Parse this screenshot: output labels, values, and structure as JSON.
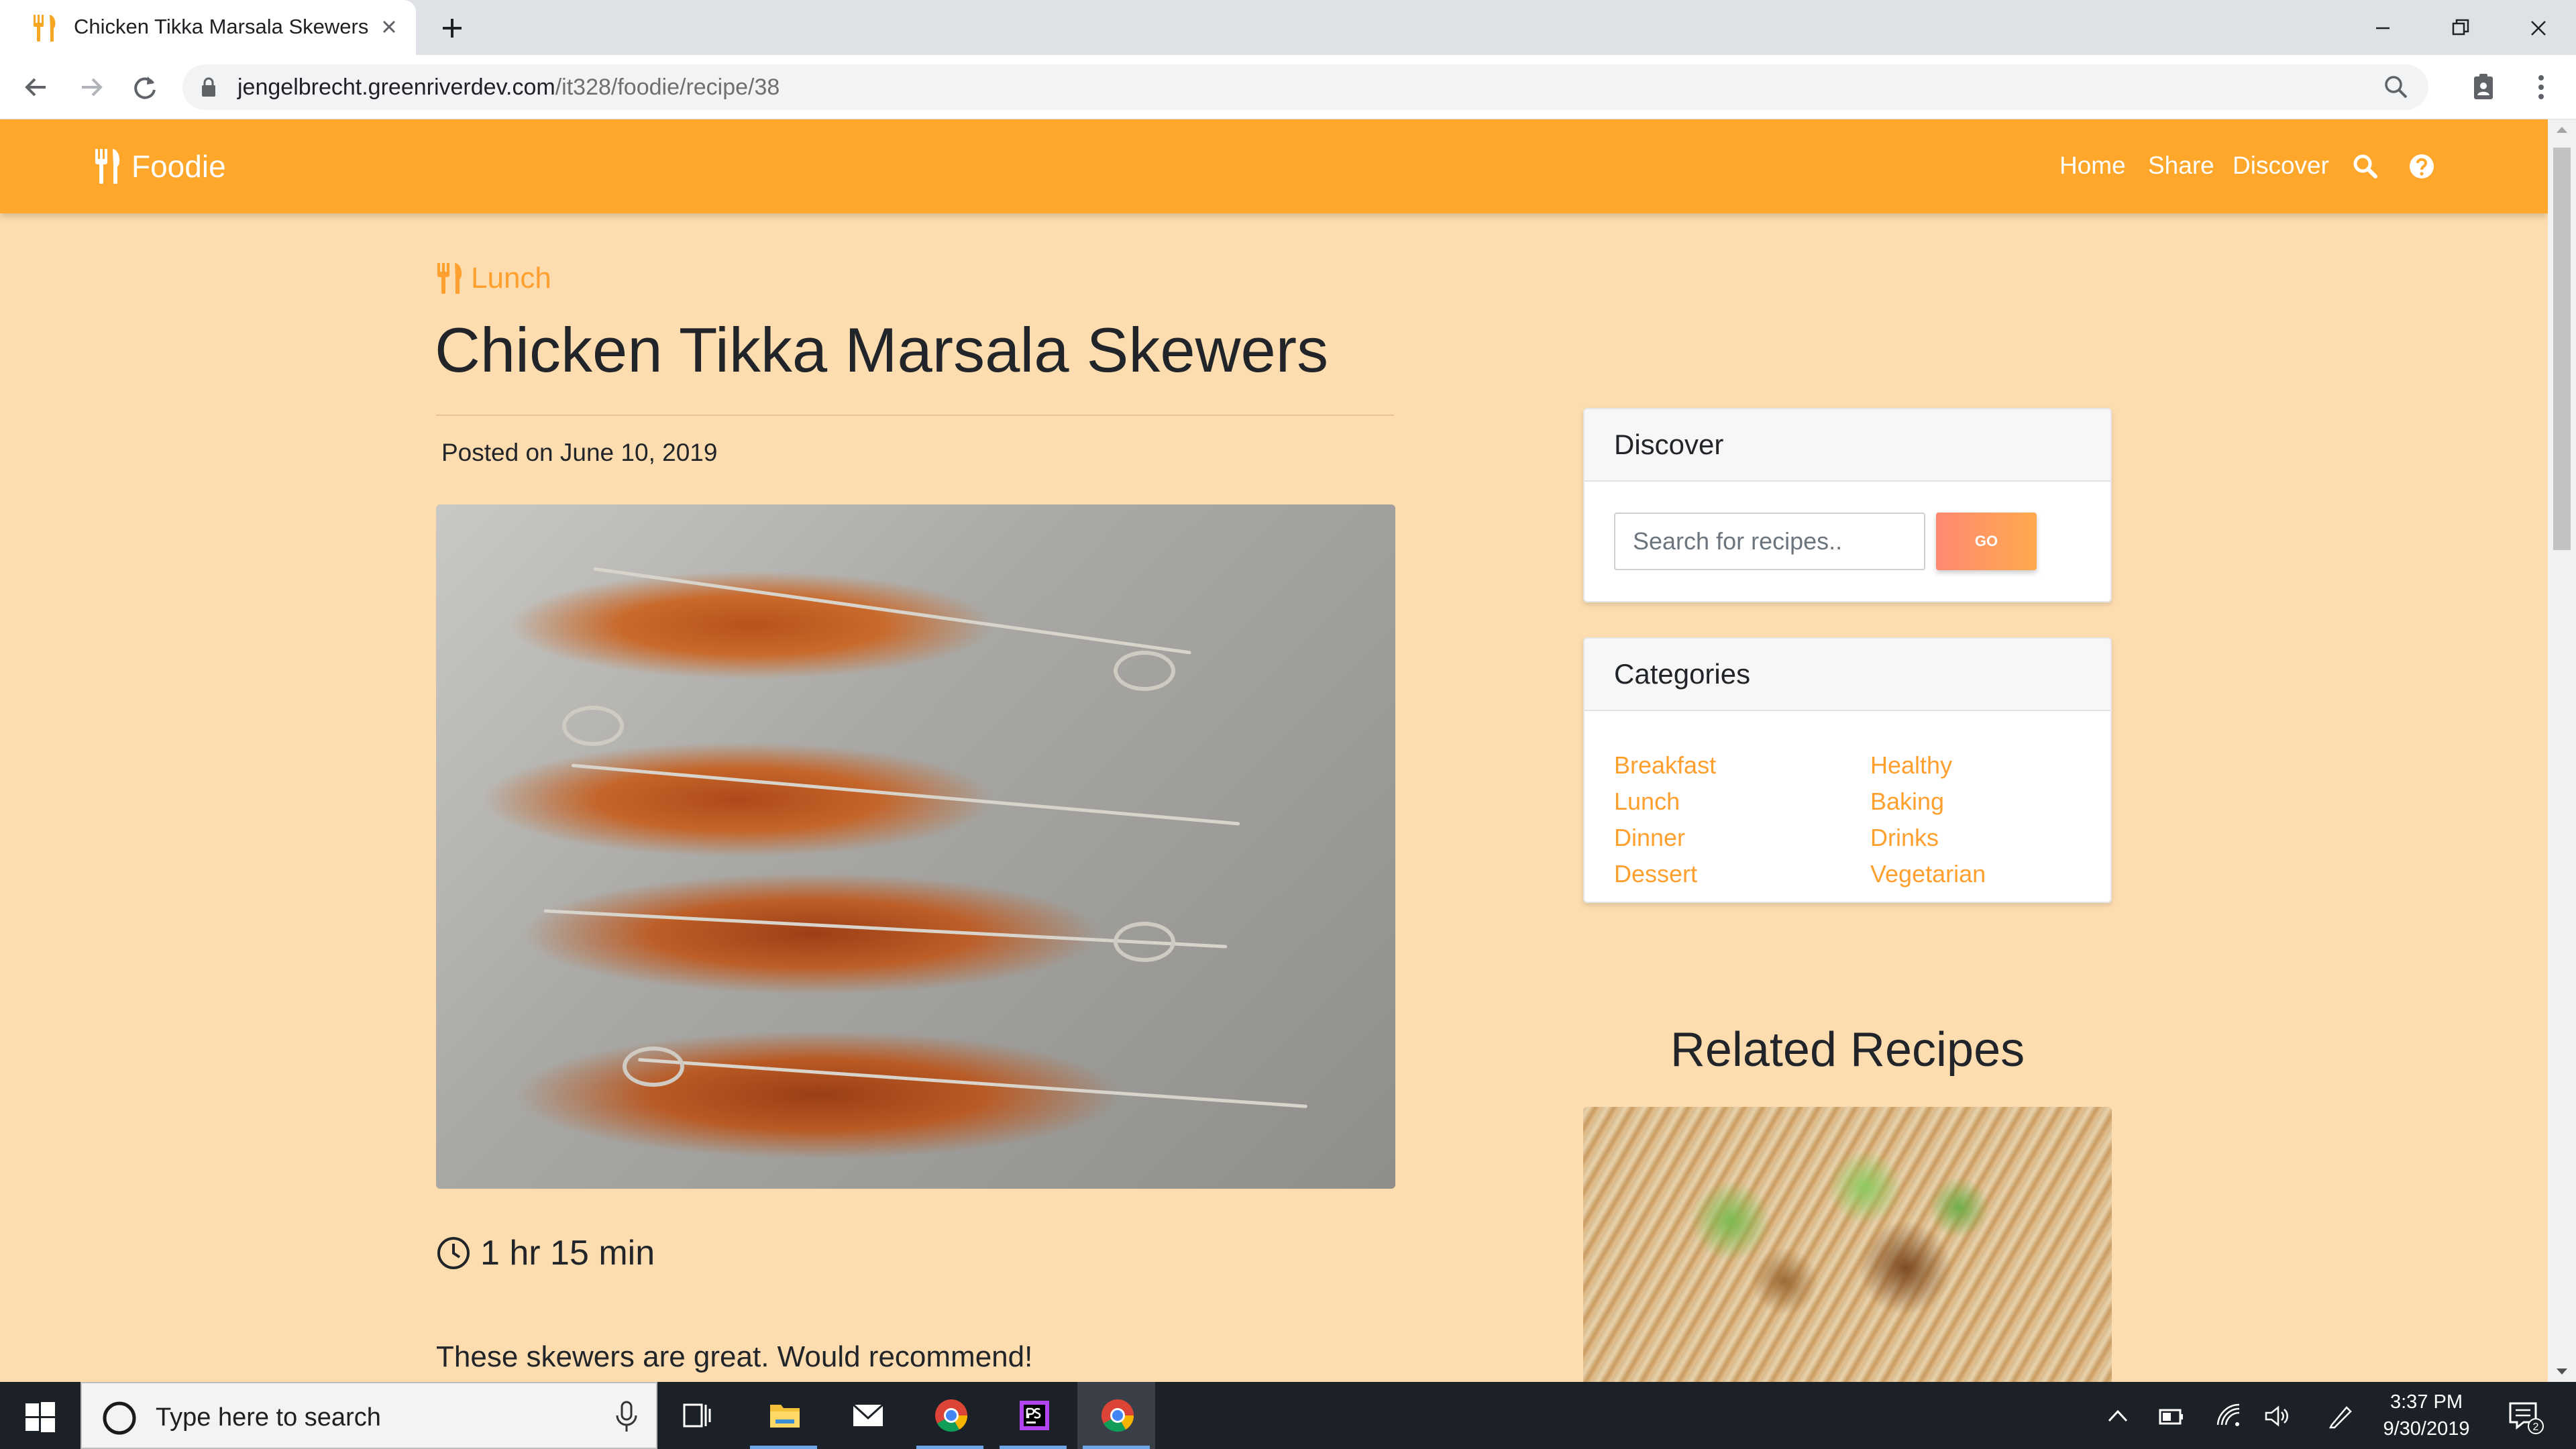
{
  "browser": {
    "tab_title": "Chicken Tikka Marsala Skewers",
    "url_host": "jengelbrecht.greenriverdev.com",
    "url_path": "/it328/foodie/recipe/38"
  },
  "site": {
    "brand": "Foodie",
    "nav": {
      "home": "Home",
      "share": "Share",
      "discover": "Discover"
    }
  },
  "recipe": {
    "category": "Lunch",
    "title": "Chicken Tikka Marsala Skewers",
    "posted": "Posted on June 10, 2019",
    "time": "1 hr 15 min",
    "description": "These skewers are great. Would recommend!"
  },
  "sidebar": {
    "discover": {
      "title": "Discover",
      "search_placeholder": "Search for recipes..",
      "go_label": "GO"
    },
    "categories": {
      "title": "Categories",
      "left": [
        "Breakfast",
        "Lunch",
        "Dinner",
        "Dessert"
      ],
      "right": [
        "Healthy",
        "Baking",
        "Drinks",
        "Vegetarian"
      ]
    },
    "related_title": "Related Recipes"
  },
  "taskbar": {
    "search_placeholder": "Type here to search",
    "time": "3:37 PM",
    "date": "9/30/2019",
    "notification_count": "2"
  },
  "colors": {
    "nav_orange": "#ffa72a",
    "page_bg": "#fdddaf",
    "link_orange": "#ff9f2e"
  }
}
